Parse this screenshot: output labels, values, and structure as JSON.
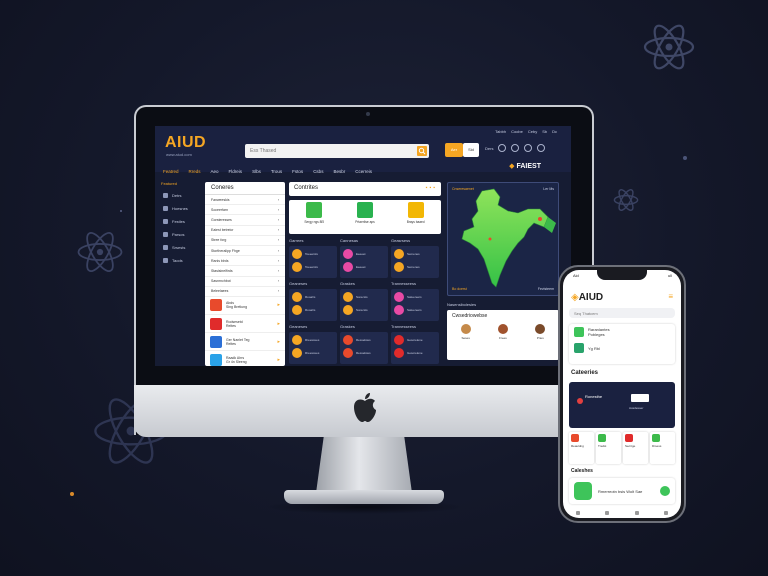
{
  "desktop": {
    "logo": "AIUD",
    "logo_sub": "www.aiud.com",
    "search_placeholder": "Ess Thased",
    "top_links": [
      "Tabbh",
      "Coobe",
      "Ceby",
      "Sb",
      "Dc"
    ],
    "login_label": "Aer",
    "signup_label": "Sid",
    "icon_row_label": "Ders",
    "nav": [
      "Featred",
      "Rreds",
      "Aeo",
      "Fldreis",
      "Slbs",
      "Trous",
      "Fstos",
      "Csbs",
      "Besbr",
      "Ccerreis"
    ],
    "nav_right": "FAIEST",
    "sidebar_label": "Featured",
    "sidebar": [
      "Detrs",
      "Hoesnes",
      "Festles",
      "Parsos",
      "Srsests",
      "Taods"
    ],
    "categories_title": "Coneres",
    "category_items": [
      "Fanweeskis",
      "Soceerfarn",
      "Gorsteresses",
      "Eaiest betreicr",
      "Stree forg",
      "Stortheralipp Fhge",
      "Ranis blrds",
      "Stasisinelfirds",
      "Sasnrnchbot",
      "Beleelaees"
    ],
    "category_apps": [
      {
        "name": "Abds",
        "sub": "Sing Bretlung",
        "color": "#e84a2c"
      },
      {
        "name": "Rodsesetd",
        "sub": "Reltes",
        "color": "#e02b2b"
      },
      {
        "name": "Ger Nanlet Teg",
        "sub": "Reltes",
        "color": "#2b6fd6"
      },
      {
        "name": "Raadk Ahrs",
        "sub": "Gr 4n Sleeng",
        "color": "#2aa2e8"
      }
    ],
    "main_title": "Contrites",
    "featured": [
      {
        "label": "Sergy ngs 8El",
        "color": "#3cba4a"
      },
      {
        "label": "Prtaerlise aps",
        "color": "#29b24f"
      },
      {
        "label": "Brays baaed",
        "color": "#f2b705"
      }
    ],
    "grid_headers": [
      "Garrees",
      "Cannesas",
      "Geasrsess"
    ],
    "grid_rows": [
      [
        {
          "t": "Toeeersls",
          "c": "#f5a623"
        },
        {
          "t": "Eeeeet",
          "c": "#e84aa5"
        },
        {
          "t": "Semenes",
          "c": "#f5a623"
        }
      ],
      [
        {
          "t": "Rooalrs",
          "c": "#f5a623"
        },
        {
          "t": "Sorecsts",
          "c": "#f5a623"
        },
        {
          "t": "Satuereers",
          "c": "#e84aa5"
        }
      ],
      [
        {
          "t": "Rreescees",
          "c": "#f5a623"
        },
        {
          "t": "Resselstes",
          "c": "#e84a2c"
        },
        {
          "t": "Gesorelene",
          "c": "#e02b2b"
        }
      ]
    ],
    "grid_section_titles": [
      "Geaneses",
      "Graskes",
      "Trannesseess"
    ],
    "map_label": "Cnseresaenet",
    "map_label_right": "Ler Ms",
    "map_foot": "Bo dcerst",
    "map_foot_right": "Fevisteem",
    "below_map_title": "Nasensibolesies",
    "below_map": {
      "title": "Cwsedriowebse",
      "people": [
        {
          "name": "Seses",
          "color": "#c58a4a"
        },
        {
          "name": "Frees",
          "color": "#a0522d"
        },
        {
          "name": "Pries",
          "color": "#7a4a2a"
        }
      ]
    }
  },
  "phone": {
    "time": "Aid",
    "status_right": "ull",
    "logo": "AIUD",
    "search": "Seq Thatcem",
    "card_rows": [
      {
        "t": "Raranlantes",
        "sub": "Pobleges",
        "c": "#3ec45a"
      },
      {
        "t": "Yg Rbl",
        "sub": "",
        "c": "#29a36b"
      }
    ],
    "section_title": "Cateeries",
    "banner_left": "Ronesthe",
    "banner_right": "Aosdesoer",
    "tiles": [
      {
        "t": "Reauldng",
        "c": "#e84a2c"
      },
      {
        "t": "Tredst",
        "c": "#3cba4a"
      },
      {
        "t": "Secrtge",
        "c": "#e02b2b"
      },
      {
        "t": "Drsess",
        "c": "#3cba4a"
      }
    ],
    "section2_title": "Caleshes",
    "app": {
      "t": "Rmerreotn bsis Wolt Sae"
    }
  }
}
